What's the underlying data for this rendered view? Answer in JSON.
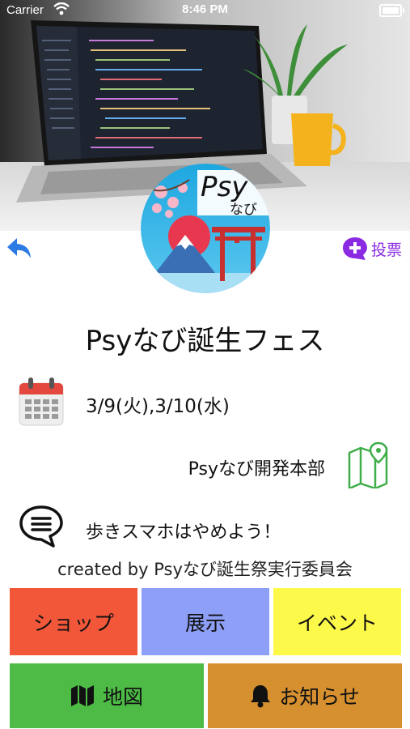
{
  "status_bar": {
    "carrier": "Carrier",
    "time": "8:46 PM"
  },
  "hero": {
    "image": "laptop-with-code-on-desk"
  },
  "logo": {
    "text_main": "Psy",
    "text_sub": "なび"
  },
  "nav": {
    "vote_label": "投票"
  },
  "event": {
    "title": "Psyなび誕生フェス",
    "date": "3/9(火),3/10(水)",
    "place": "Psyなび開発本部",
    "notice": "歩きスマホはやめよう！",
    "credit": "created by Psyなび誕生祭実行委員会"
  },
  "buttons": {
    "shop": "ショップ",
    "exhibit": "展示",
    "event": "イベント",
    "map": "地図",
    "news": "お知らせ"
  },
  "colors": {
    "shop": "#f2573a",
    "exhibit": "#8d9ff6",
    "event": "#fdf94a",
    "map": "#4dbb45",
    "news": "#d7902f",
    "back_arrow": "#2c7be5",
    "vote": "#8a2be2"
  }
}
